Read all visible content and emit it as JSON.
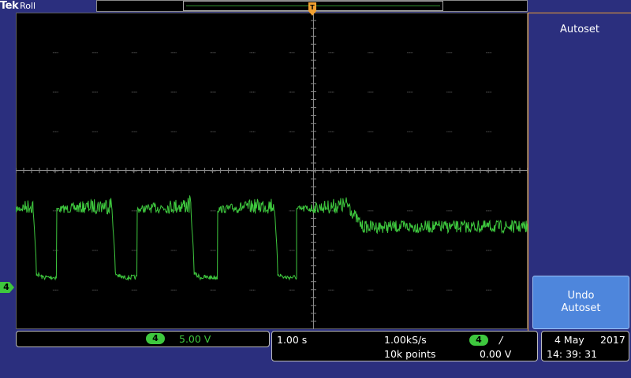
{
  "top_bar": {
    "brand": "Tek",
    "mode": "Roll"
  },
  "side_menu": {
    "autoset_label": "Autoset",
    "undo_line1": "Undo",
    "undo_line2": "Autoset"
  },
  "channel": {
    "number": "4",
    "scale": "5.00 V",
    "marker_label": "4"
  },
  "timebase": {
    "scale": "1.00 s",
    "sample_rate": "1.00kS/s",
    "record_length": "10k points",
    "trigger_channel": "4",
    "trigger_slope_symbol": "/",
    "trigger_level": "0.00 V"
  },
  "datetime": {
    "date": "4 May",
    "year": "2017",
    "time": "14: 39: 31"
  },
  "colors": {
    "background": "#2b2f7e",
    "trace": "#3ec83e",
    "accent": "#f0a030",
    "button": "#4e86dc"
  }
}
